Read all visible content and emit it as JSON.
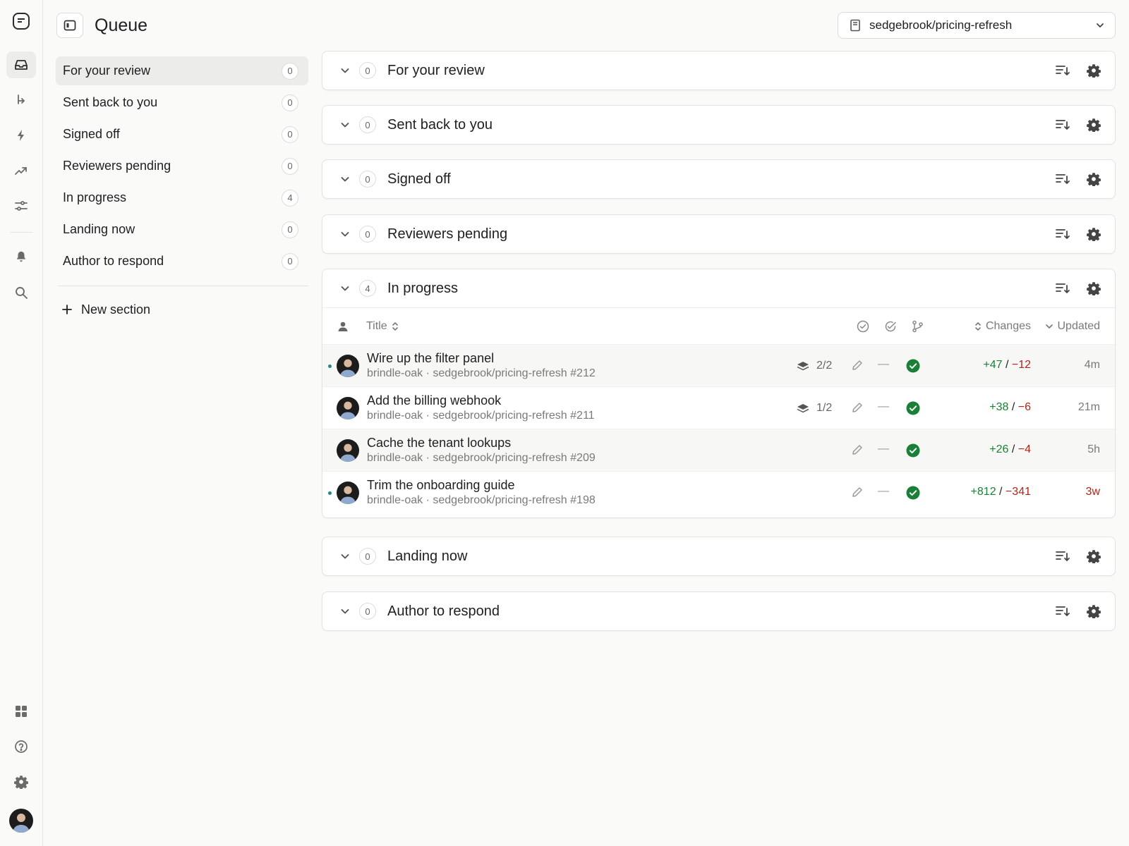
{
  "header": {
    "title": "Queue",
    "repo": "sedgebrook/pricing-refresh"
  },
  "nav": {
    "items": [
      {
        "label": "For your review",
        "count": "0"
      },
      {
        "label": "Sent back to you",
        "count": "0"
      },
      {
        "label": "Signed off",
        "count": "0"
      },
      {
        "label": "Reviewers pending",
        "count": "0"
      },
      {
        "label": "In progress",
        "count": "4"
      },
      {
        "label": "Landing now",
        "count": "0"
      },
      {
        "label": "Author to respond",
        "count": "0"
      }
    ],
    "new_section": "New section"
  },
  "sections": [
    {
      "title": "For your review",
      "count": "0"
    },
    {
      "title": "Sent back to you",
      "count": "0"
    },
    {
      "title": "Signed off",
      "count": "0"
    },
    {
      "title": "Reviewers pending",
      "count": "0"
    },
    {
      "title": "In progress",
      "count": "4"
    },
    {
      "title": "Landing now",
      "count": "0"
    },
    {
      "title": "Author to respond",
      "count": "0"
    }
  ],
  "table": {
    "columns": {
      "title": "Title",
      "changes": "Changes",
      "updated": "Updated"
    },
    "rows": [
      {
        "title": "Wire up the filter panel",
        "meta": "brindle-oak · sedgebrook/pricing-refresh #212",
        "stack": "2/2",
        "review": "—",
        "added": "+47",
        "removed": "−12",
        "updated": "4m",
        "unread": true
      },
      {
        "title": "Add the billing webhook",
        "meta": "brindle-oak · sedgebrook/pricing-refresh #211",
        "stack": "1/2",
        "review": "—",
        "added": "+38",
        "removed": "−6",
        "updated": "21m",
        "unread": false
      },
      {
        "title": "Cache the tenant lookups",
        "meta": "brindle-oak · sedgebrook/pricing-refresh #209",
        "stack": "",
        "review": "—",
        "added": "+26",
        "removed": "−4",
        "updated": "5h",
        "unread": false
      },
      {
        "title": "Trim the onboarding guide",
        "meta": "brindle-oak · sedgebrook/pricing-refresh #198",
        "stack": "",
        "review": "—",
        "added": "+812",
        "removed": "−341",
        "updated": "3w",
        "unread": true
      }
    ]
  },
  "colors": {
    "added": "#1a7f37",
    "removed": "#b42318",
    "check": "#1a7f37",
    "unread_dot": "#1f8a83"
  }
}
